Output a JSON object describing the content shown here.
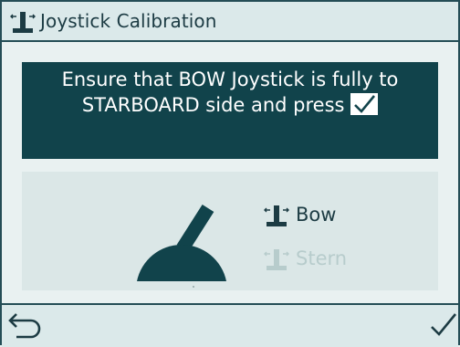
{
  "header": {
    "title": "Joystick Calibration",
    "icon": "joystick-icon"
  },
  "instruction": {
    "line1": "Ensure that BOW Joystick is fully to",
    "line2_text": "STARBOARD side and press",
    "confirm_icon": "check-icon"
  },
  "illustration": {
    "graphic": "joystick-tilted-starboard",
    "options": [
      {
        "label": "Bow",
        "state": "active",
        "icon": "joystick-icon"
      },
      {
        "label": "Stern",
        "state": "inactive",
        "icon": "joystick-icon"
      }
    ]
  },
  "footer": {
    "back_icon": "back-arrow-icon",
    "confirm_icon": "check-icon"
  },
  "colors": {
    "dark": "#11434b",
    "text": "#1c3b43",
    "inactive": "#b7cccc",
    "background": "#e9f1f1",
    "panel": "#dbe7e7"
  }
}
